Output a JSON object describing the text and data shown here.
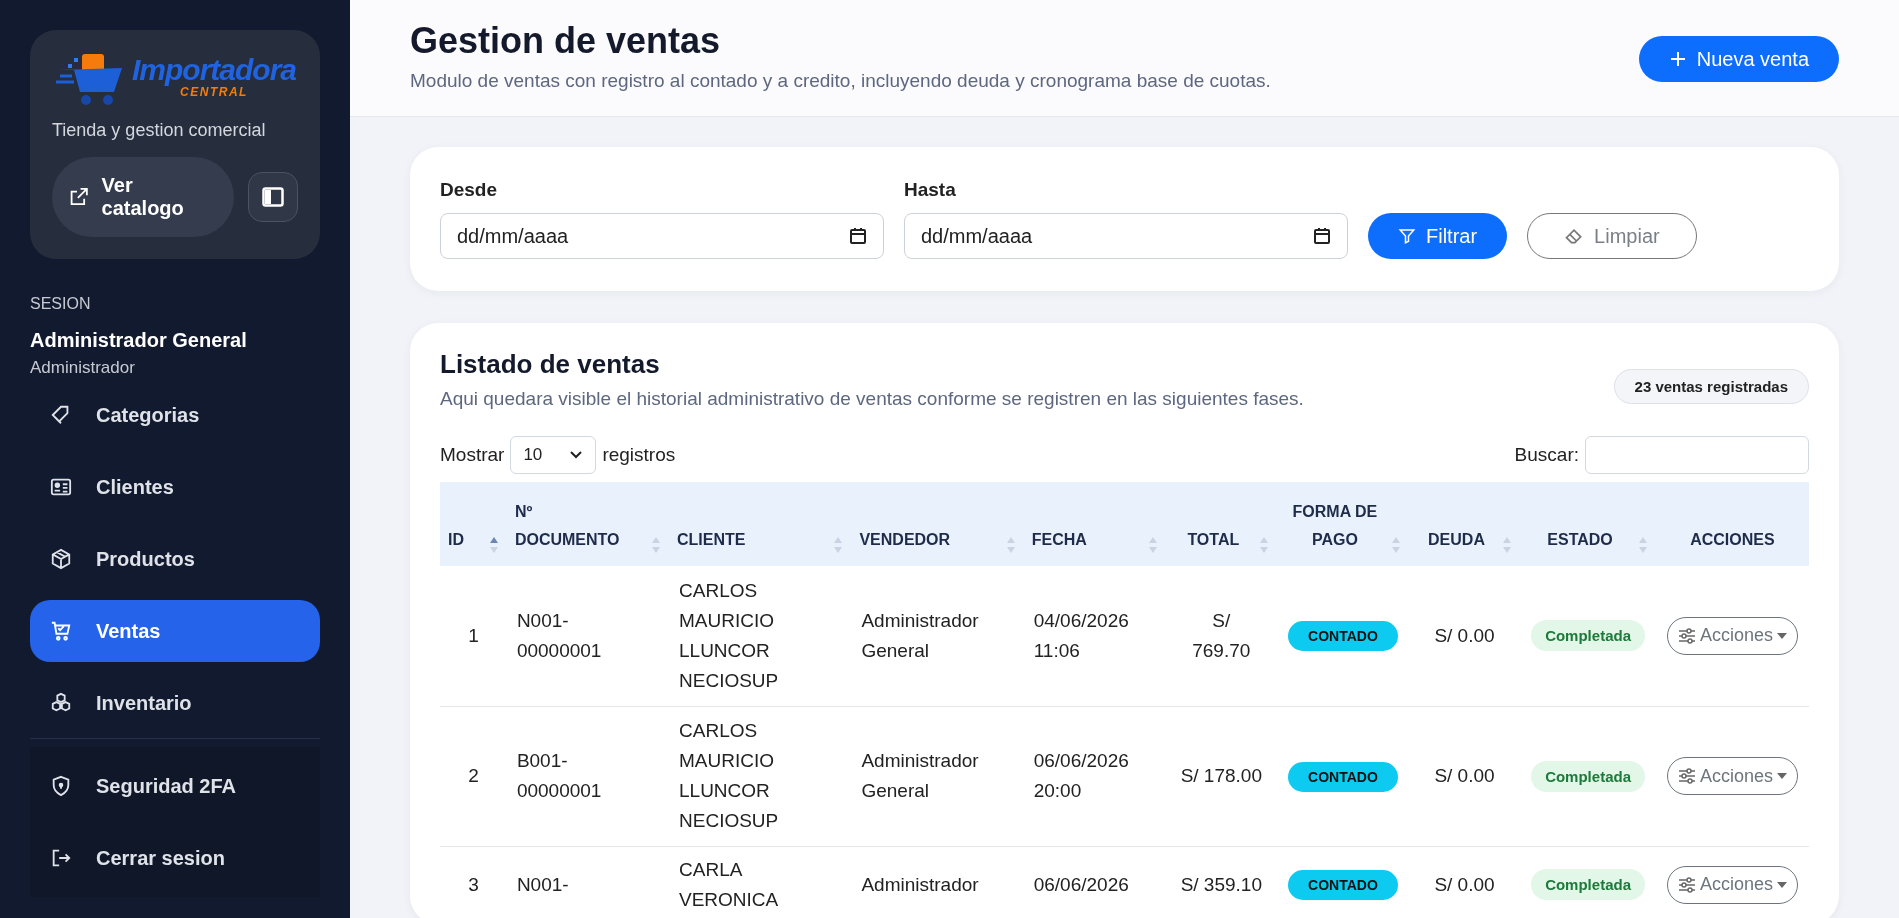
{
  "sidebar": {
    "brand": {
      "name": "Importadora",
      "sub": "CENTRAL",
      "tagline": "Tienda y gestion comercial"
    },
    "catalog_button": "Ver catalogo",
    "session": {
      "label": "SESION",
      "user": "Administrador General",
      "role": "Administrador"
    },
    "nav": [
      {
        "label": "Categorias",
        "kind": "tag",
        "selected": false
      },
      {
        "label": "Clientes",
        "kind": "card",
        "selected": false
      },
      {
        "label": "Productos",
        "kind": "box",
        "selected": false
      },
      {
        "label": "Ventas",
        "kind": "cart",
        "selected": true
      },
      {
        "label": "Inventario",
        "kind": "cubes",
        "selected": false
      }
    ],
    "bottom": [
      {
        "label": "Seguridad 2FA",
        "kind": "shield"
      },
      {
        "label": "Cerrar sesion",
        "kind": "logout"
      }
    ]
  },
  "header": {
    "title": "Gestion de ventas",
    "subtitle": "Modulo de ventas con registro al contado y a credito, incluyendo deuda y cronograma base de cuotas.",
    "new_button": "Nueva venta"
  },
  "filters": {
    "from": {
      "label": "Desde",
      "placeholder": "dd/mm/aaaa"
    },
    "to": {
      "label": "Hasta",
      "placeholder": "dd/mm/aaaa"
    },
    "filter_button": "Filtrar",
    "clear_button": "Limpiar"
  },
  "listing": {
    "title": "Listado de ventas",
    "subtitle": "Aqui quedara visible el historial administrativo de ventas conforme se registren en las siguientes fases.",
    "count_badge": "23 ventas registradas",
    "show_label": "Mostrar",
    "page_size": "10",
    "records_label": "registros",
    "search_label": "Buscar:",
    "columns": [
      {
        "lines": [
          "ID"
        ],
        "sorted": true
      },
      {
        "lines": [
          "Nº",
          "DOCUMENTO"
        ],
        "sorted": false
      },
      {
        "lines": [
          "CLIENTE"
        ],
        "sorted": false
      },
      {
        "lines": [
          "VENDEDOR"
        ],
        "sorted": false
      },
      {
        "lines": [
          "FECHA"
        ],
        "sorted": false
      },
      {
        "lines": [
          "TOTAL"
        ],
        "sorted": false
      },
      {
        "lines": [
          "FORMA DE",
          "PAGO"
        ],
        "sorted": false
      },
      {
        "lines": [
          "DEUDA"
        ],
        "sorted": false
      },
      {
        "lines": [
          "ESTADO"
        ],
        "sorted": false
      },
      {
        "lines": [
          "ACCIONES"
        ]
      }
    ],
    "rows": [
      {
        "id": "1",
        "document": [
          "N001-",
          "00000001"
        ],
        "client": [
          "CARLOS",
          "MAURICIO",
          "LLUNCOR",
          "NECIOSUP"
        ],
        "seller": [
          "Administrador",
          "General"
        ],
        "date": [
          "04/06/2026",
          "11:06"
        ],
        "total": [
          "S/",
          "769.70"
        ],
        "payment": "CONTADO",
        "debt": "S/ 0.00",
        "status": "Completada",
        "action": "Acciones"
      },
      {
        "id": "2",
        "document": [
          "B001-",
          "00000001"
        ],
        "client": [
          "CARLOS",
          "MAURICIO",
          "LLUNCOR",
          "NECIOSUP"
        ],
        "seller": [
          "Administrador",
          "General"
        ],
        "date": [
          "06/06/2026",
          "20:00"
        ],
        "total": [
          "S/ 178.00"
        ],
        "payment": "CONTADO",
        "debt": "S/ 0.00",
        "status": "Completada",
        "action": "Acciones"
      },
      {
        "id": "3",
        "document": [
          "N001-"
        ],
        "client": [
          "CARLA",
          "VERONICA"
        ],
        "seller": [
          "Administrador"
        ],
        "date": [
          "06/06/2026"
        ],
        "total": [
          "S/ 359.10"
        ],
        "payment": "CONTADO",
        "debt": "S/ 0.00",
        "status": "Completada",
        "action": "Acciones"
      }
    ]
  }
}
